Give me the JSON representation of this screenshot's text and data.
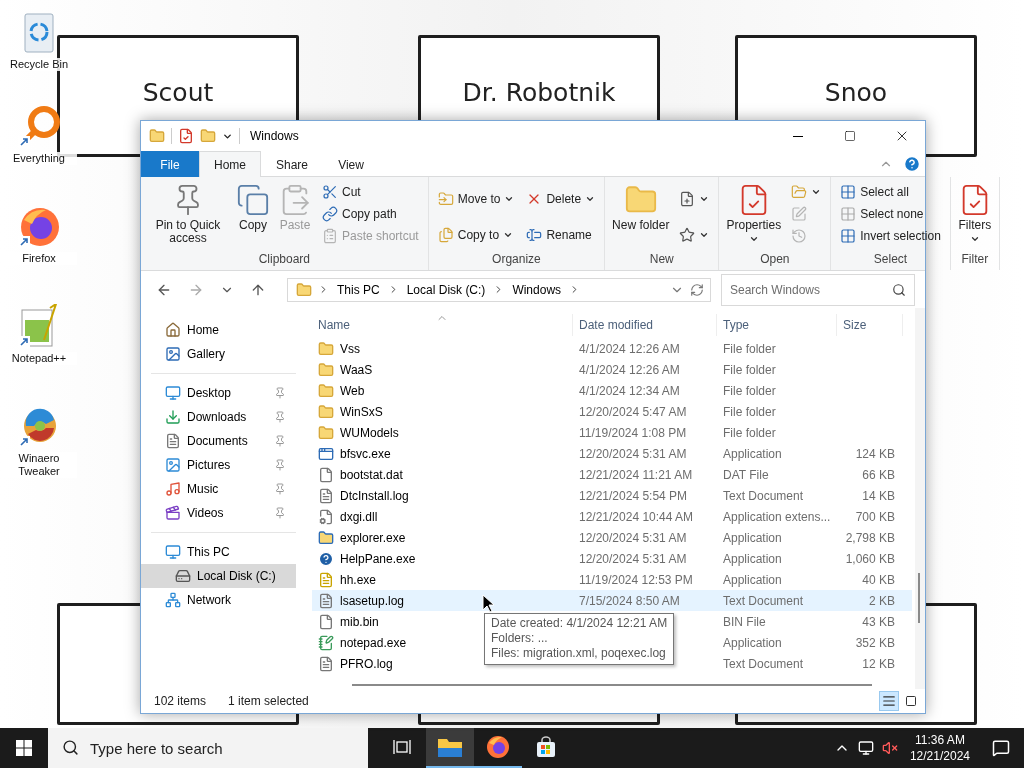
{
  "desktop": {
    "wallpaper_labels": [
      "Scout",
      "Dr. Robotnik",
      "Snoo"
    ],
    "icons": [
      {
        "label": "Recycle Bin",
        "kind": "recycle"
      },
      {
        "label": "Everything",
        "kind": "everything"
      },
      {
        "label": "Firefox",
        "kind": "firefox"
      },
      {
        "label": "Notepad++",
        "kind": "notepad"
      },
      {
        "label": "Winaero Tweaker",
        "kind": "winaero"
      }
    ]
  },
  "window": {
    "title": "Windows",
    "tabs": [
      {
        "label": "File",
        "kind": "file",
        "selected": false
      },
      {
        "label": "Home",
        "kind": "tab",
        "selected": true
      },
      {
        "label": "Share",
        "kind": "tab",
        "selected": false
      },
      {
        "label": "View",
        "kind": "tab",
        "selected": false
      }
    ],
    "ribbon": [
      {
        "name": "Clipboard",
        "items": [
          {
            "kind": "large",
            "label": "Pin to Quick access",
            "disabled": false
          },
          {
            "kind": "large",
            "label": "Copy",
            "disabled": false
          },
          {
            "kind": "large",
            "label": "Paste",
            "disabled": true
          },
          {
            "kind": "stack",
            "items": [
              {
                "label": "Cut",
                "disabled": false
              },
              {
                "label": "Copy path",
                "disabled": false
              },
              {
                "label": "Paste shortcut",
                "disabled": true
              }
            ]
          }
        ]
      },
      {
        "name": "Organize",
        "items": [
          {
            "kind": "stack",
            "items": [
              {
                "label": "Move to",
                "dropdown": true
              },
              {
                "label": "Copy to",
                "dropdown": true
              }
            ]
          },
          {
            "kind": "stack",
            "items": [
              {
                "label": "Delete",
                "dropdown": true
              },
              {
                "label": "Rename",
                "dropdown": false
              }
            ]
          }
        ]
      },
      {
        "name": "New",
        "items": [
          {
            "kind": "large",
            "label": "New folder",
            "disabled": false
          },
          {
            "kind": "stack",
            "items": [
              {
                "dropdown": true
              },
              {
                "dropdown": true
              }
            ]
          }
        ]
      },
      {
        "name": "Open",
        "items": [
          {
            "kind": "large",
            "label": "Properties",
            "dropdown": true
          },
          {
            "kind": "stack",
            "items": [
              {
                "dropdown": true,
                "disabled": false
              },
              {
                "disabled": true
              },
              {
                "disabled": true
              }
            ]
          }
        ]
      },
      {
        "name": "Select",
        "items": [
          {
            "kind": "stack",
            "items": [
              {
                "label": "Select all"
              },
              {
                "label": "Select none"
              },
              {
                "label": "Invert selection"
              }
            ]
          }
        ]
      },
      {
        "name": "Filter",
        "items": [
          {
            "kind": "large",
            "label": "Filters",
            "dropdown": true
          }
        ]
      }
    ],
    "address": {
      "crumbs": [
        "This PC",
        "Local Disk (C:)",
        "Windows"
      ]
    },
    "search": {
      "placeholder": "Search Windows"
    },
    "nav": [
      {
        "items": [
          {
            "label": "Home",
            "selected": false
          },
          {
            "label": "Gallery",
            "selected": false
          }
        ]
      },
      {
        "items": [
          {
            "label": "Desktop",
            "selected": false,
            "pinned": true
          },
          {
            "label": "Downloads",
            "selected": false,
            "pinned": true
          },
          {
            "label": "Documents",
            "selected": false,
            "pinned": true
          },
          {
            "label": "Pictures",
            "selected": false,
            "pinned": true
          },
          {
            "label": "Music",
            "selected": false,
            "pinned": true
          },
          {
            "label": "Videos",
            "selected": false,
            "pinned": true
          }
        ]
      },
      {
        "items": [
          {
            "label": "This PC",
            "selected": false,
            "children": [
              {
                "label": "Local Disk (C:)",
                "selected": true
              }
            ]
          },
          {
            "label": "Network",
            "selected": false
          }
        ]
      }
    ],
    "columns": [
      {
        "label": "Name",
        "sorted": true
      },
      {
        "label": "Date modified",
        "sorted": false
      },
      {
        "label": "Type",
        "sorted": false
      },
      {
        "label": "Size",
        "sorted": false
      }
    ],
    "rows": [
      {
        "kind": "folder",
        "name": "Vss",
        "date": "4/1/2024 12:26 AM",
        "type": "File folder",
        "selected": false
      },
      {
        "kind": "folder",
        "name": "WaaS",
        "date": "4/1/2024 12:26 AM",
        "type": "File folder",
        "selected": false
      },
      {
        "kind": "folder",
        "name": "Web",
        "date": "4/1/2024 12:34 AM",
        "type": "File folder",
        "selected": false
      },
      {
        "kind": "folder",
        "name": "WinSxS",
        "date": "12/20/2024 5:47 AM",
        "type": "File folder",
        "selected": false
      },
      {
        "kind": "folder",
        "name": "WUModels",
        "date": "11/19/2024 1:08 PM",
        "type": "File folder",
        "selected": false
      },
      {
        "kind": "app",
        "name": "bfsvc.exe",
        "date": "12/20/2024 5:31 AM",
        "type": "Application",
        "size": "124 KB",
        "selected": false
      },
      {
        "kind": "blank",
        "name": "bootstat.dat",
        "date": "12/21/2024 11:21 AM",
        "type": "DAT File",
        "size": "66 KB",
        "selected": false
      },
      {
        "kind": "text",
        "name": "DtcInstall.log",
        "date": "12/21/2024 5:54 PM",
        "type": "Text Document",
        "size": "14 KB",
        "selected": false
      },
      {
        "kind": "dll",
        "name": "dxgi.dll",
        "date": "12/21/2024 10:44 AM",
        "type": "Application extens...",
        "size": "700 KB",
        "selected": false
      },
      {
        "kind": "explorer",
        "name": "explorer.exe",
        "date": "12/20/2024 5:31 AM",
        "type": "Application",
        "size": "2,798 KB",
        "selected": false
      },
      {
        "kind": "help",
        "name": "HelpPane.exe",
        "date": "12/20/2024 5:31 AM",
        "type": "Application",
        "size": "1,060 KB",
        "selected": false
      },
      {
        "kind": "hh",
        "name": "hh.exe",
        "date": "11/19/2024 12:53 PM",
        "type": "Application",
        "size": "40 KB",
        "selected": false
      },
      {
        "kind": "text",
        "name": "lsasetup.log",
        "date": "7/15/2024 8:50 AM",
        "type": "Text Document",
        "size": "2 KB",
        "selected": true
      },
      {
        "kind": "blank",
        "name": "mib.bin",
        "type": "BIN File",
        "size": "43 KB",
        "selected": false
      },
      {
        "kind": "notepad",
        "name": "notepad.exe",
        "type": "Application",
        "size": "352 KB",
        "selected": false
      },
      {
        "kind": "text",
        "name": "PFRO.log",
        "type": "Text Document",
        "size": "12 KB",
        "selected": false
      }
    ],
    "tooltip": [
      "Date created: 4/1/2024 12:21 AM",
      "Folders: ...",
      "Files: migration.xml, poqexec.log"
    ],
    "status": {
      "count": "102 items",
      "selection": "1 item selected"
    },
    "views": [
      {
        "selected": true
      },
      {
        "selected": false
      }
    ]
  },
  "taskbar": {
    "search": {
      "placeholder": "Type here to search"
    },
    "apps": [
      {
        "kind": "explorer",
        "selected": true,
        "running": true
      },
      {
        "kind": "firefox",
        "selected": false,
        "running": true
      },
      {
        "kind": "store",
        "selected": false,
        "running": false
      }
    ],
    "muted": true,
    "time": "11:36 AM",
    "date": "12/21/2024"
  }
}
